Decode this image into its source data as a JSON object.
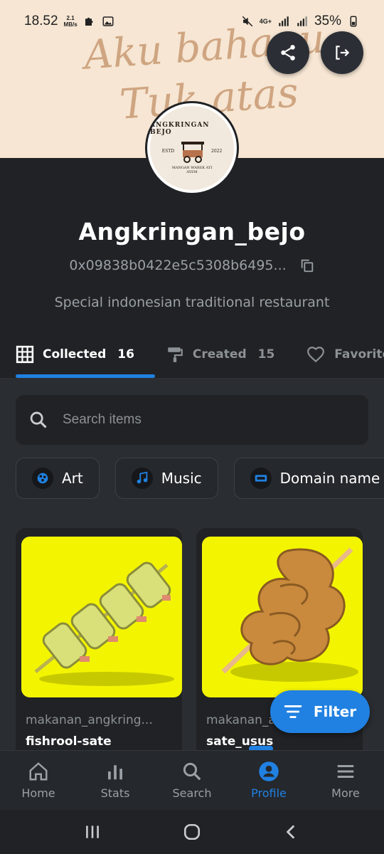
{
  "status_bar": {
    "time": "18.52",
    "speed_value": "2.1",
    "speed_unit": "MB/s",
    "network": "4G+",
    "battery": "35%"
  },
  "banner": {
    "script_line1": "Aku bahagu",
    "script_line2": "Tuk   atas"
  },
  "avatar": {
    "logo_title": "ANGKRINGAN BEJO",
    "logo_estd": "ESTD",
    "logo_year": "2022",
    "logo_tagline": "MANGAN WAREK ATI AYEM"
  },
  "profile": {
    "name": "Angkringan_bejo",
    "address": "0x09838b0422e5c5308b6495...",
    "description": "Special indonesian traditional restaurant"
  },
  "tabs": [
    {
      "label": "Collected",
      "count": "16"
    },
    {
      "label": "Created",
      "count": "15"
    },
    {
      "label": "Favorite"
    }
  ],
  "search": {
    "placeholder": "Search items"
  },
  "chips": [
    {
      "label": "Art"
    },
    {
      "label": "Music"
    },
    {
      "label": "Domain name"
    }
  ],
  "cards": [
    {
      "collection": "makanan_angkring...",
      "title": "fishrool-sate"
    },
    {
      "collection": "makanan_angkring...",
      "title": "sate_usus"
    }
  ],
  "filter": {
    "label": "Filter"
  },
  "bottom_nav": [
    {
      "label": "Home"
    },
    {
      "label": "Stats"
    },
    {
      "label": "Search"
    },
    {
      "label": "Profile"
    },
    {
      "label": "More"
    }
  ],
  "colors": {
    "accent": "#2081e2",
    "background": "#202225",
    "banner": "#f6e6d3",
    "card_image": "#f3f500"
  }
}
